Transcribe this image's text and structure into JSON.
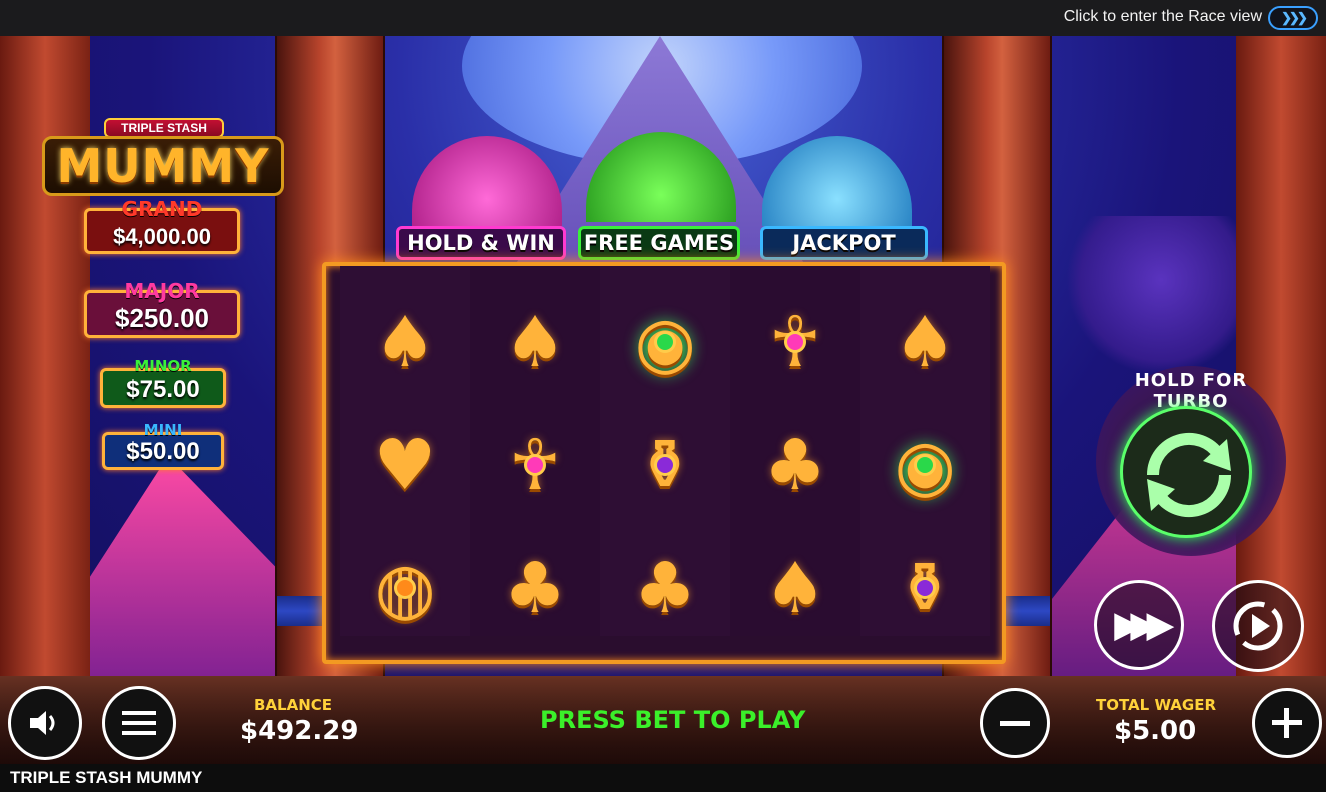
{
  "topbar": {
    "race_text": "Click to enter the Race view",
    "race_icon": "triple-chevron-right-icon"
  },
  "game": {
    "title": "TRIPLE STASH MUMMY",
    "logo": {
      "top": "TRIPLE STASH",
      "word": "MUMMY"
    }
  },
  "jackpots": [
    {
      "name": "GRAND",
      "value": "$4,000.00",
      "name_color": "#ff3a2a"
    },
    {
      "name": "MAJOR",
      "value": "$250.00",
      "name_color": "#ff3aa0"
    },
    {
      "name": "MINOR",
      "value": "$75.00",
      "name_color": "#3af03a"
    },
    {
      "name": "MINI",
      "value": "$50.00",
      "name_color": "#3ab8ff"
    }
  ],
  "features": [
    {
      "label": "HOLD & WIN",
      "color": "#ff3ad0"
    },
    {
      "label": "FREE GAMES",
      "color": "#3af03a"
    },
    {
      "label": "JACKPOT",
      "color": "#3ab8ff"
    }
  ],
  "reels": [
    [
      "spade",
      "spade",
      "eye",
      "ankh",
      "spade"
    ],
    [
      "heart",
      "ankh",
      "vase",
      "club",
      "eye"
    ],
    [
      "scarab",
      "club",
      "club",
      "spade",
      "vase"
    ]
  ],
  "turbo": {
    "label": "HOLD FOR TURBO",
    "icon": "spin-arrows-icon"
  },
  "controls": {
    "sound_icon": "speaker-icon",
    "menu_icon": "hamburger-menu-icon",
    "balance_label": "BALANCE",
    "balance_value": "$492.29",
    "message": "PRESS BET TO PLAY",
    "minus_icon": "minus-icon",
    "wager_label": "TOTAL WAGER",
    "wager_value": "$5.00",
    "plus_icon": "plus-icon",
    "fast_icon": "fast-forward-icon",
    "autoplay_icon": "autoplay-icon"
  },
  "colors": {
    "accent": "#f39a22",
    "message": "#3bf02a",
    "label": "#ffd23a"
  }
}
